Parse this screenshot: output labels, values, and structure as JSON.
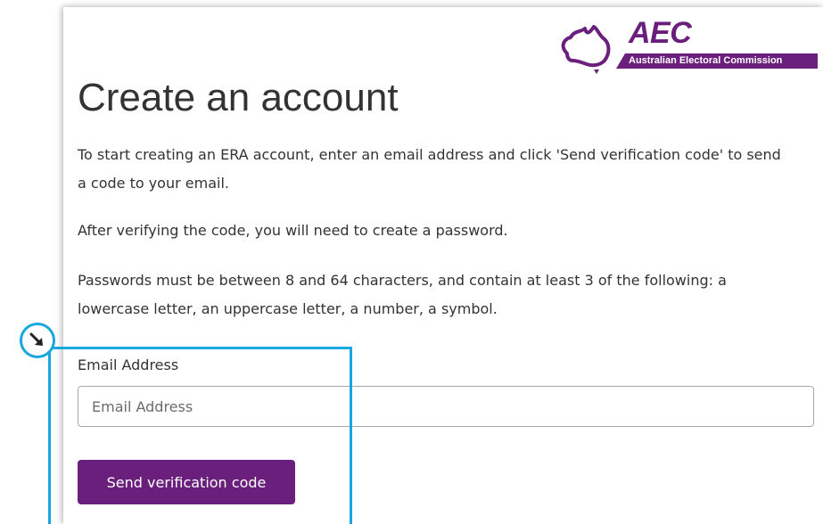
{
  "logo": {
    "acronym": "AEC",
    "full_name": "Australian Electoral Commission",
    "brand_color": "#6b1f7c",
    "icon": "australia-map-icon"
  },
  "page": {
    "title": "Create an account",
    "intro": "To start creating an ERA account, enter an email address and click 'Send verification code' to send a code to your email.",
    "verify_note": "After verifying the code, you will need to create a password.",
    "password_rules": "Passwords must be between 8 and 64 characters, and contain at least 3 of the following: a lowercase letter, an uppercase letter, a number, a symbol."
  },
  "form": {
    "email_label": "Email Address",
    "email_placeholder": "Email Address",
    "email_value": "",
    "send_button_label": "Send verification code"
  },
  "annotation": {
    "highlight_color": "#1aa7df",
    "badge_icon": "arrow-down-right-icon"
  }
}
